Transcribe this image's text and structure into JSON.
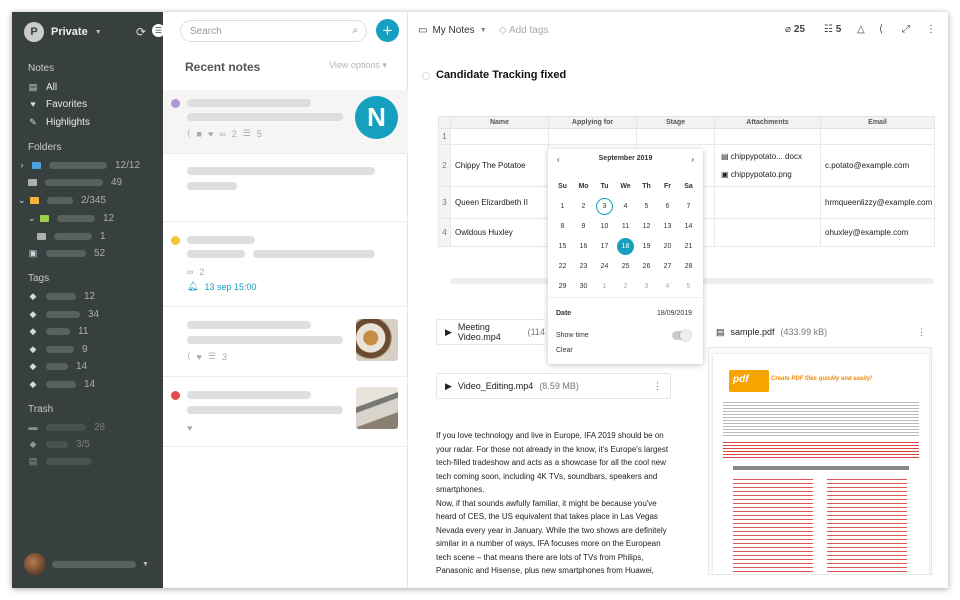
{
  "sidebar": {
    "user_initial": "P",
    "user_name": "Private",
    "notes_header": "Notes",
    "notes": [
      {
        "label": "All",
        "icon": "file-icon"
      },
      {
        "label": "Favorites",
        "icon": "heart-icon"
      },
      {
        "label": "Highlights",
        "icon": "pen-icon"
      }
    ],
    "folders_header": "Folders",
    "folders": [
      {
        "count": "12/12"
      },
      {
        "count": "49"
      },
      {
        "count": "2/345"
      },
      {
        "count": "12"
      },
      {
        "count": "1"
      },
      {
        "count": "52"
      }
    ],
    "tags_header": "Tags",
    "tags": [
      {
        "count": "12"
      },
      {
        "count": "34"
      },
      {
        "count": "11"
      },
      {
        "count": "9"
      },
      {
        "count": "14"
      },
      {
        "count": "14"
      }
    ],
    "trash_header": "Trash",
    "trash": [
      {
        "count": "28"
      },
      {
        "count": "3/5"
      }
    ]
  },
  "list": {
    "search_placeholder": "Search",
    "add_label": "+",
    "title": "Recent notes",
    "view_options": "View options",
    "cards": [
      {
        "dot": "#b495d6",
        "counts": [
          "2",
          "5"
        ]
      },
      {
        "dot": ""
      },
      {
        "dot": "#f3c33b",
        "count": "2",
        "reminder": "13 sep 15:00"
      },
      {
        "dot": "",
        "counts": [
          "3"
        ]
      },
      {
        "dot": "#e34b4b"
      }
    ]
  },
  "toolbar": {
    "notebook": "My Notes",
    "add_tags": "Add tags",
    "attachments_count": "25",
    "blocks_count": "5"
  },
  "note": {
    "title": "Candidate Tracking fixed",
    "table": {
      "columns": [
        "Name",
        "Applying for",
        "Stage",
        "Attachments",
        "Email"
      ],
      "rows": [
        {
          "n": "1",
          "name": "",
          "email": ""
        },
        {
          "n": "2",
          "name": "Chippy The Potatoe",
          "email": "c.potato@example.com",
          "files": [
            "chippypotato... docx",
            "chippypotato.png"
          ]
        },
        {
          "n": "3",
          "name": "Queen Elizardbeth II",
          "email": "hrmqueenlizzy@example.com"
        },
        {
          "n": "4",
          "name": "Owldous Huxley",
          "email": "ohuxley@example.com"
        }
      ]
    },
    "calendar": {
      "month": "September 2019",
      "weekdays": [
        "Su",
        "Mo",
        "Tu",
        "We",
        "Th",
        "Fr",
        "Sa"
      ],
      "weeks": [
        [
          "1",
          "2",
          "3",
          "4",
          "5",
          "6",
          "7"
        ],
        [
          "8",
          "9",
          "10",
          "11",
          "12",
          "13",
          "14"
        ],
        [
          "15",
          "16",
          "17",
          "18",
          "19",
          "20",
          "21"
        ],
        [
          "22",
          "23",
          "24",
          "25",
          "26",
          "27",
          "28"
        ],
        [
          "29",
          "30",
          "1",
          "2",
          "3",
          "4",
          "5"
        ]
      ],
      "today": "3",
      "selected": "18",
      "date_label": "Date",
      "date_value": "18/09/2019",
      "show_time": "Show time",
      "clear": "Clear"
    },
    "attachments": [
      {
        "name": "Meeting Video.mp4",
        "size": "(114"
      },
      {
        "name": "Video_Editing.mp4",
        "size": "(8.59 MB)"
      },
      {
        "name": "sample.pdf",
        "size": "(433.99 kB)"
      }
    ],
    "pdf": {
      "logo": "pdf",
      "tagline": "Create PDF files quickly and easily!"
    },
    "paragraph1": "If you love technology and live in Europe, IFA 2019 should be on your radar. For those not already in the know, it's Europe's largest tech-filled tradeshow and acts as a showcase for all the cool new tech coming soon, including 4K TVs, soundbars, speakers and smartphones.",
    "paragraph2": "Now, if that sounds awfully familiar, it might be because you've heard of CES, the US equivalent that takes place in Las Vegas Nevada every year in January. While the two shows are definitely similar in a number of ways, IFA focuses more on the European tech scene – that means there are lots of TVs from Philips, Panasonic and Hisense, plus new smartphones from Huawei,"
  },
  "colors": {
    "accent": "#14a0be",
    "sidebar": "#38403f"
  }
}
